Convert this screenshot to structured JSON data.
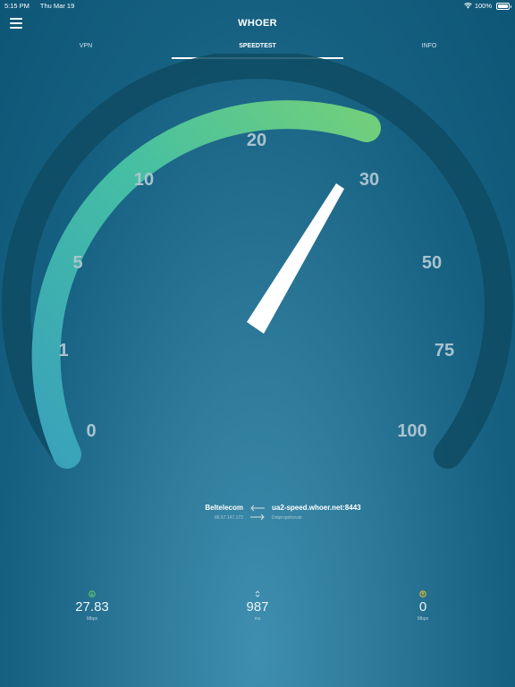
{
  "status_bar": {
    "time": "5:15 PM",
    "date": "Thu Mar 19",
    "battery": "100%"
  },
  "header": {
    "title": "WHOER",
    "menu_icon": "hamburger-menu-icon"
  },
  "tabs": [
    {
      "label": "VPN",
      "active": false
    },
    {
      "label": "SPEEDTEST",
      "active": true
    },
    {
      "label": "INFO",
      "active": false
    }
  ],
  "gauge": {
    "ticks": [
      "0",
      "1",
      "5",
      "10",
      "20",
      "30",
      "50",
      "75",
      "100"
    ],
    "current_value_mbps": 27.83,
    "colors": {
      "start": "#3aa3bb",
      "end": "#6fcf7e",
      "track": "#0e4b62",
      "needle": "#ffffff"
    }
  },
  "connection": {
    "isp_name": "Beltelecom",
    "isp_ip": "86.57.147.172",
    "server_host": "ua2-speed.whoer.net:8443",
    "server_city": "Dnipropetrovsk"
  },
  "stats": {
    "download": {
      "value": "27.83",
      "unit": "Mbps",
      "icon": "download-icon",
      "color": "#5fc96b"
    },
    "ping": {
      "value": "987",
      "unit": "ms",
      "icon": "ping-icon"
    },
    "upload": {
      "value": "0",
      "unit": "Mbps",
      "icon": "upload-icon",
      "color": "#e6c02f"
    }
  }
}
